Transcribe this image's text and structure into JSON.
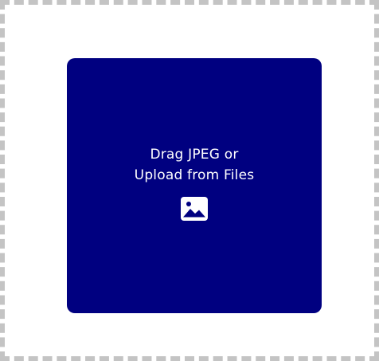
{
  "upload": {
    "line1": "Drag JPEG or",
    "line2": "Upload from Files",
    "icon": "image-icon"
  },
  "colors": {
    "dropzone_background": "#000080",
    "text": "#ffffff",
    "dashed_border": "#c4c4c4"
  }
}
